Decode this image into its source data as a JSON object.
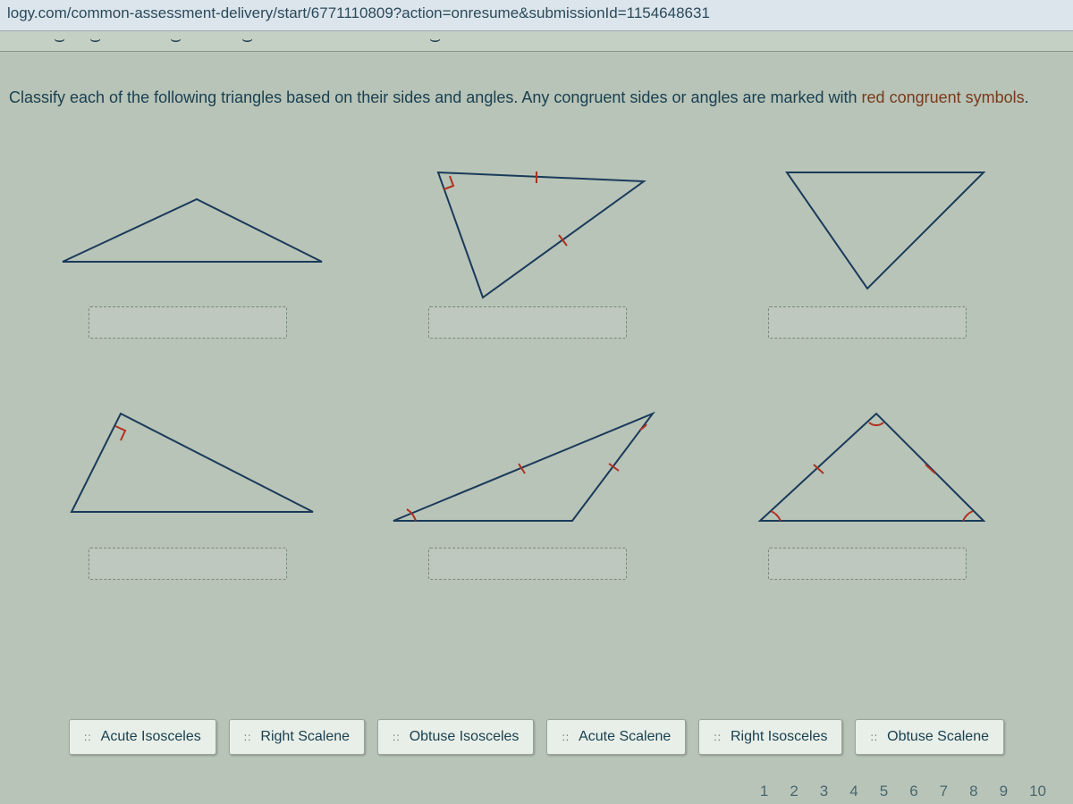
{
  "url": "logy.com/common-assessment-delivery/start/6771110809?action=onresume&submissionId=1154648631",
  "question": {
    "prefix": "Classify each of the following triangles based on their sides and angles.  Any congruent sides or angles are marked with ",
    "highlight": "red congruent symbols",
    "suffix": "."
  },
  "chips": {
    "grip": "::",
    "items": [
      "Acute Isosceles",
      "Right Scalene",
      "Obtuse Isosceles",
      "Acute Scalene",
      "Right Isosceles",
      "Obtuse Scalene"
    ]
  },
  "pager": [
    "1",
    "2",
    "3",
    "4",
    "5",
    "6",
    "7",
    "8",
    "9",
    "10"
  ]
}
